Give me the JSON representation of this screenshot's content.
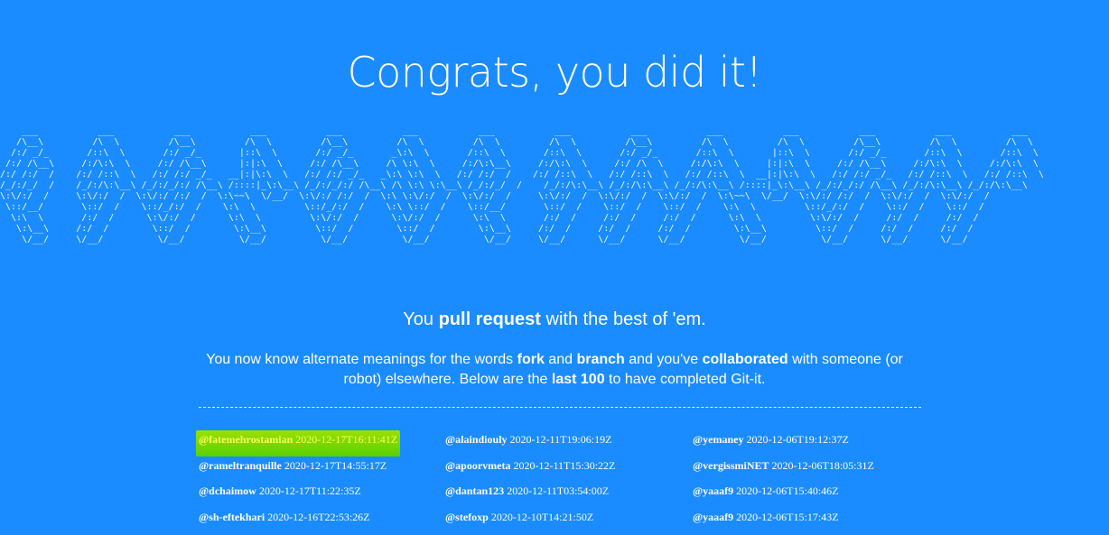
{
  "heading": "Congrats, you did it!",
  "ascii_art": "    ___           ___           ___           ___           ___           ___           ___           ___           ___           ___           ___           ___           ___           ___\n   /\\__\\         /\\  \\         /\\__\\         /\\  \\         /\\__\\         /\\  \\         /\\  \\         /\\  \\         /\\__\\         /\\  \\         /\\  \\         /\\__\\         /\\  \\         /\\  \\\n  /:/ _/_       /::\\  \\       /:/ _/_       |::\\  \\       /:/ _/_       _\\:\\  \\       /::\\  \\       /::\\  \\       /:/ _/_       /::\\  \\       |::\\  \\       /:/ _/_       /::\\  \\       /::\\  \\\n /:/ /\\__\\     /:/\\:\\  \\     /:/ /\\__\\      |:|:\\  \\     /:/ /\\__\\     /\\ \\:\\  \\     /:/\\:\\__\\     /:/\\:\\  \\     /:/ /\\  \\     /:/\\:\\  \\     |:|:\\  \\     /:/ /\\__\\     /:/\\:\\  \\     /:/\\:\\  \\\n/:/ /:/  /    /:/ /::\\  \\   /:/ /:/ _/_   __|:|\\:\\  \\   /:/ /:/ _/_   _\\:\\ \\:\\  \\   /:/ /:/  /    /:/ /::\\  \\   /:/ /::\\  \\   /:/ /::\\  \\  __|:|\\:\\  \\   /:/ /:/ _/_   /:/ /::\\  \\   /:/ /::\\  \\\n/_/:/_/  /    /_/:/\\:\\__\\ /_/:/_/:/ /\\__\\ /::::|_\\:\\__\\ /_/:/_/:/ /\\__\\ /\\ \\:\\ \\:\\__\\ /_/:/_/  /    /_/:/\\:\\__\\ /_/:/\\:\\__\\ /_/:/\\:\\__\\ /::::|_\\:\\__\\ /_/:/_/:/ /\\__\\ /_/:/\\:\\__\\ /_/:/\\:\\__\\\n\\:\\/:/  /     \\:\\/:/  /  \\:\\/:/ /:/  /  \\:\\~~\\  \\/__/  \\:\\/:/ /:/  /  \\:\\ \\:\\/:/  /  \\:\\/:/  /     \\:\\/:/  /  \\:\\/:/  /  \\:\\/:/  /  \\:\\~~\\  \\/__/  \\:\\/:/ /:/  /  \\:\\/:/  /  \\:\\/:/  /\n \\::/__/       \\::/  /    \\::/_/:/  /    \\:\\  \\         \\::/_/:/  /    \\:\\ \\::/  /    \\::/__/       \\::/  /    \\::/  /    \\::/  /    \\:\\  \\         \\::/_/:/  /    \\::/  /    \\::/  /\n  \\:\\  \\       /:/  /      \\:\\/:/  /      \\:\\  \\         \\:\\/:/  /      \\:\\/:/  /      \\:\\  \\       /:/  /     /:/  /     /:/  /      \\:\\  \\         \\:\\/:/  /     /:/  /     /:/  /\n   \\:\\__\\     /:/  /        \\::/  /        \\:\\__\\         \\::/  /        \\::/  /        \\:\\__\\     /:/  /     /:/  /     /:/  /        \\:\\__\\         \\::/  /     /:/  /     /:/  /\n    \\/__/     \\/__/          \\/__/          \\/__/          \\/__/          \\/__/          \\/__/     \\/__/      \\/__/      \\/__/          \\/__/          \\/__/      \\/__/      \\/__/",
  "tagline": {
    "prefix": "You ",
    "bold": "pull request",
    "suffix": " with the best of 'em."
  },
  "description": {
    "p1": "You now know alternate meanings for the words ",
    "b1": "fork",
    "p2": " and ",
    "b2": "branch",
    "p3": " and you've ",
    "b3": "collaborated",
    "p4": " with someone (or robot) elsewhere. Below are the ",
    "b4": "last 100",
    "p5": " to have completed Git-it."
  },
  "completions": [
    {
      "user": "@fatemehrostamian",
      "date": "2020-12-17T16:11:41Z"
    },
    {
      "user": "@alaindiouly",
      "date": "2020-12-11T19:06:19Z"
    },
    {
      "user": "@yemaney",
      "date": "2020-12-06T19:12:37Z"
    },
    {
      "user": "@rameltranquille",
      "date": "2020-12-17T14:55:17Z"
    },
    {
      "user": "@apoorvmeta",
      "date": "2020-12-11T15:30:22Z"
    },
    {
      "user": "@vergissmiNET",
      "date": "2020-12-06T18:05:31Z"
    },
    {
      "user": "@dchaimow",
      "date": "2020-12-17T11:22:35Z"
    },
    {
      "user": "@dantan123",
      "date": "2020-12-11T03:54:00Z"
    },
    {
      "user": "@yaaaf9",
      "date": "2020-12-06T15:40:46Z"
    },
    {
      "user": "@sh-eftekhari",
      "date": "2020-12-16T22:53:26Z"
    },
    {
      "user": "@stefoxp",
      "date": "2020-12-10T14:21:50Z"
    },
    {
      "user": "@yaaaf9",
      "date": "2020-12-06T15:17:43Z"
    }
  ],
  "colors": {
    "background": "#1a8cff",
    "text": "#ffffff",
    "highlight": "#7ddc00",
    "highlight_text": "#ffff66"
  }
}
